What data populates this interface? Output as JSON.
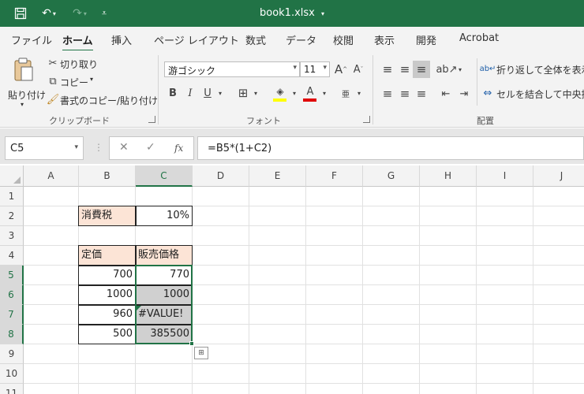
{
  "titlebar": {
    "filename": "book1.xlsx",
    "save_icon": "save-icon",
    "undo_icon": "undo-icon",
    "redo_icon": "redo-icon",
    "customize_icon": "customize-quick-access-icon"
  },
  "tabs": [
    "ファイル",
    "ホーム",
    "挿入",
    "ページ レイアウト",
    "数式",
    "データ",
    "校閲",
    "表示",
    "開発",
    "Acrobat"
  ],
  "active_tab": "ホーム",
  "ribbon": {
    "paste_label": "貼り付け",
    "cut_label": "切り取り",
    "copy_label": "コピー",
    "format_painter_label": "書式のコピー/貼り付け",
    "clipboard_group": "クリップボード",
    "font_name": "游ゴシック",
    "font_size": "11",
    "font_group": "フォント",
    "wrap_text_label": "折り返して全体を表示す",
    "merge_center_label": "セルを結合して中央揃え",
    "alignment_group": "配置"
  },
  "formula_bar": {
    "name_box": "C5",
    "formula": "=B5*(1+C2)"
  },
  "columns": [
    "A",
    "B",
    "C",
    "D",
    "E",
    "F",
    "G",
    "H",
    "I",
    "J"
  ],
  "rows": [
    "1",
    "2",
    "3",
    "4",
    "5",
    "6",
    "7",
    "8",
    "9",
    "10",
    "11"
  ],
  "cells": {
    "B2": "消費税",
    "C2": "10%",
    "B4": "定価",
    "C4": "販売価格",
    "B5": "700",
    "C5": "770",
    "B6": "1000",
    "C6": "1000",
    "B7": "960",
    "C7": "#VALUE!",
    "B8": "500",
    "C8": "385500"
  },
  "colors": {
    "accent": "#217346",
    "header_fill": "#fce4d6",
    "selection_fill": "#d0d0d0"
  }
}
